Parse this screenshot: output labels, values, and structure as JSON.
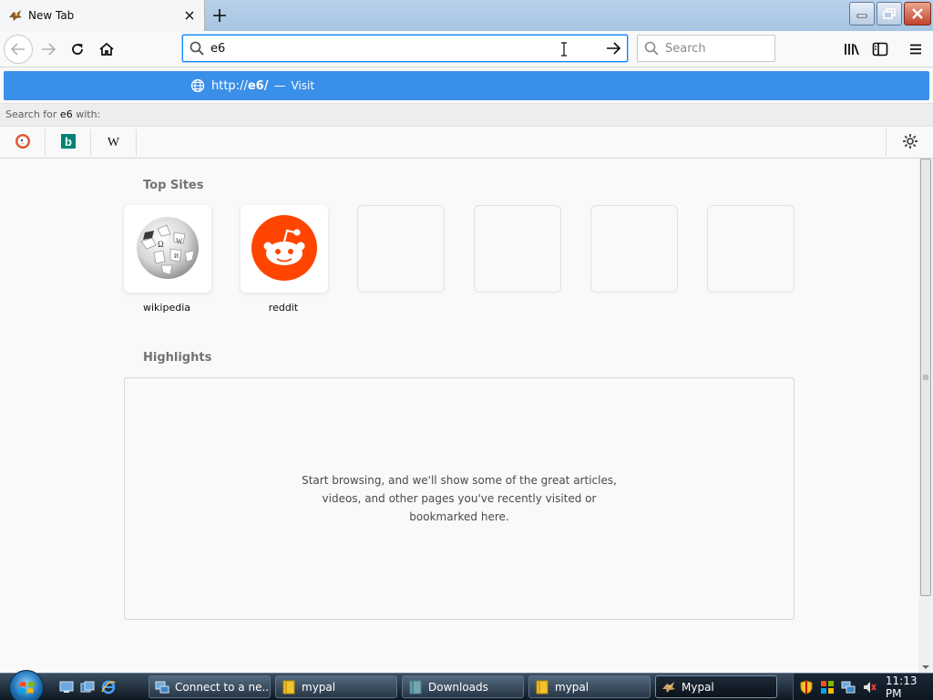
{
  "tab": {
    "title": "New Tab"
  },
  "navbar": {
    "url_value": "e6",
    "search_placeholder": "Search"
  },
  "dropdown": {
    "result": {
      "url_prefix": "http://",
      "url_bold": "e6/",
      "separator": "—",
      "action": "Visit"
    },
    "search_with_prefix": "Search for",
    "search_with_term": "e6",
    "search_with_suffix": "with:",
    "engines": [
      {
        "name": "DuckDuckGo",
        "icon": "duckduckgo-icon"
      },
      {
        "name": "Bing",
        "icon": "bing-icon",
        "glyph": "b"
      },
      {
        "name": "Wikipedia",
        "icon": "wikipedia-icon",
        "glyph": "W"
      }
    ]
  },
  "content": {
    "top_sites_title": "Top Sites",
    "top_sites": [
      {
        "label": "wikipedia",
        "icon": "wikipedia-globe-icon"
      },
      {
        "label": "reddit",
        "icon": "reddit-icon"
      }
    ],
    "highlights_title": "Highlights",
    "highlights_message": "Start browsing, and we'll show some of the great articles, videos, and other pages you've recently visited or bookmarked here."
  },
  "taskbar": {
    "tasks": [
      {
        "label": "Connect to a ne...",
        "icon": "network-icon"
      },
      {
        "label": "mypal",
        "icon": "folder-icon"
      },
      {
        "label": "Downloads",
        "icon": "downloads-folder-icon"
      },
      {
        "label": "mypal",
        "icon": "folder-icon"
      },
      {
        "label": "Mypal",
        "icon": "mypal-browser-icon",
        "active": true
      }
    ],
    "clock": "11:13 PM"
  },
  "colors": {
    "accent": "#0a84ff",
    "result_highlight": "#3a8fe8",
    "reddit_orange": "#ff4500",
    "bing_teal": "#008373",
    "ddg_orange": "#de5833"
  }
}
